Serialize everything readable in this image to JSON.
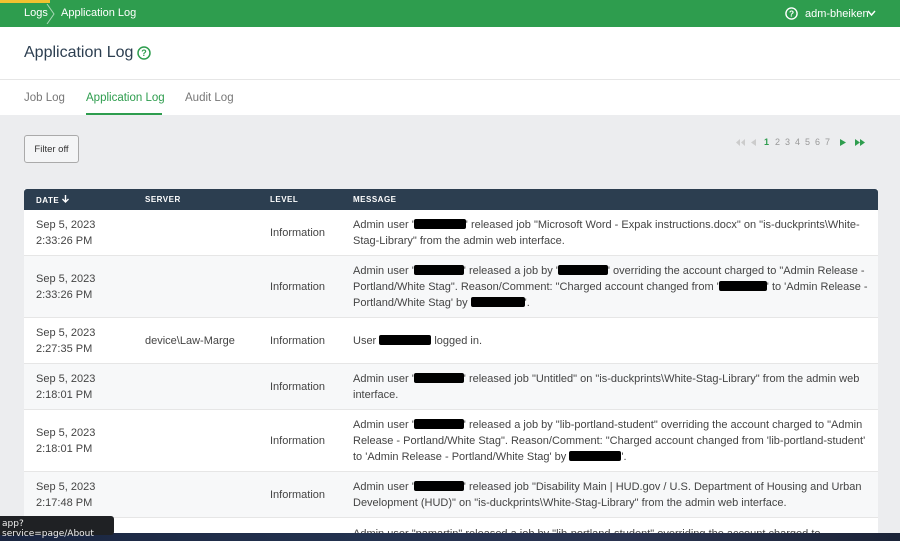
{
  "breadcrumb": {
    "root": "Logs",
    "current": "Application Log"
  },
  "user": {
    "name": "adm-bheiken"
  },
  "page": {
    "title": "Application Log"
  },
  "tabs": [
    "Job Log",
    "Application Log",
    "Audit Log"
  ],
  "filter": {
    "label": "Filter off"
  },
  "pagination": {
    "pages": [
      "1",
      "2",
      "3",
      "4",
      "5",
      "6",
      "7"
    ],
    "current": "1"
  },
  "table": {
    "headers": [
      "DATE",
      "SERVER",
      "LEVEL",
      "MESSAGE"
    ],
    "rows": [
      {
        "date": "Sep 5, 2023",
        "time": "2:33:26 PM",
        "server": "",
        "level": "Information",
        "msg_a": "Admin user '",
        "msg_b": "' released job \"Microsoft Word - Expak instructions.docx\" on \"is-duckprints\\White-Stag-Library\" from the admin web interface."
      },
      {
        "date": "Sep 5, 2023",
        "time": "2:33:26 PM",
        "server": "",
        "level": "Information",
        "msg_a": "Admin user '",
        "msg_b": "' released a job by '",
        "msg_c": "' overriding the account charged to \"Admin Release - Portland/White Stag\". Reason/Comment: \"Charged account changed from '",
        "msg_d": "' to 'Admin Release - Portland/White Stag' by ",
        "msg_e": "'."
      },
      {
        "date": "Sep 5, 2023",
        "time": "2:27:35 PM",
        "server": "device\\Law-Marge",
        "level": "Information",
        "msg_a": "User ",
        "msg_b": " logged in."
      },
      {
        "date": "Sep 5, 2023",
        "time": "2:18:01 PM",
        "server": "",
        "level": "Information",
        "msg_a": "Admin user '",
        "msg_b": "' released job \"Untitled\" on \"is-duckprints\\White-Stag-Library\" from the admin web interface."
      },
      {
        "date": "Sep 5, 2023",
        "time": "2:18:01 PM",
        "server": "",
        "level": "Information",
        "msg_a": "Admin user '",
        "msg_b": "' released a job by \"lib-portland-student\" overriding the account charged to \"Admin Release - Portland/White Stag\". Reason/Comment: \"Charged account changed from 'lib-portland-student' to 'Admin Release - Portland/White Stag' by ",
        "msg_c": "'."
      },
      {
        "date": "Sep 5, 2023",
        "time": "2:17:48 PM",
        "server": "",
        "level": "Information",
        "msg_a": "Admin user '",
        "msg_b": "' released job \"Disability Main | HUD.gov / U.S. Department of Housing and Urban Development (HUD)\" on \"is-duckprints\\White-Stag-Library\" from the admin web interface."
      },
      {
        "date": "",
        "time": "",
        "server": "",
        "level": "",
        "msg_a": "Admin user \"pamartin\" released a job by \"lib-portland-student\" overriding the account charged to"
      }
    ]
  },
  "status_url": "app?service=page/About",
  "colors": {
    "brand": "#2e9d4e",
    "header_dark": "#2c3e50",
    "accent": "#f2c230"
  }
}
